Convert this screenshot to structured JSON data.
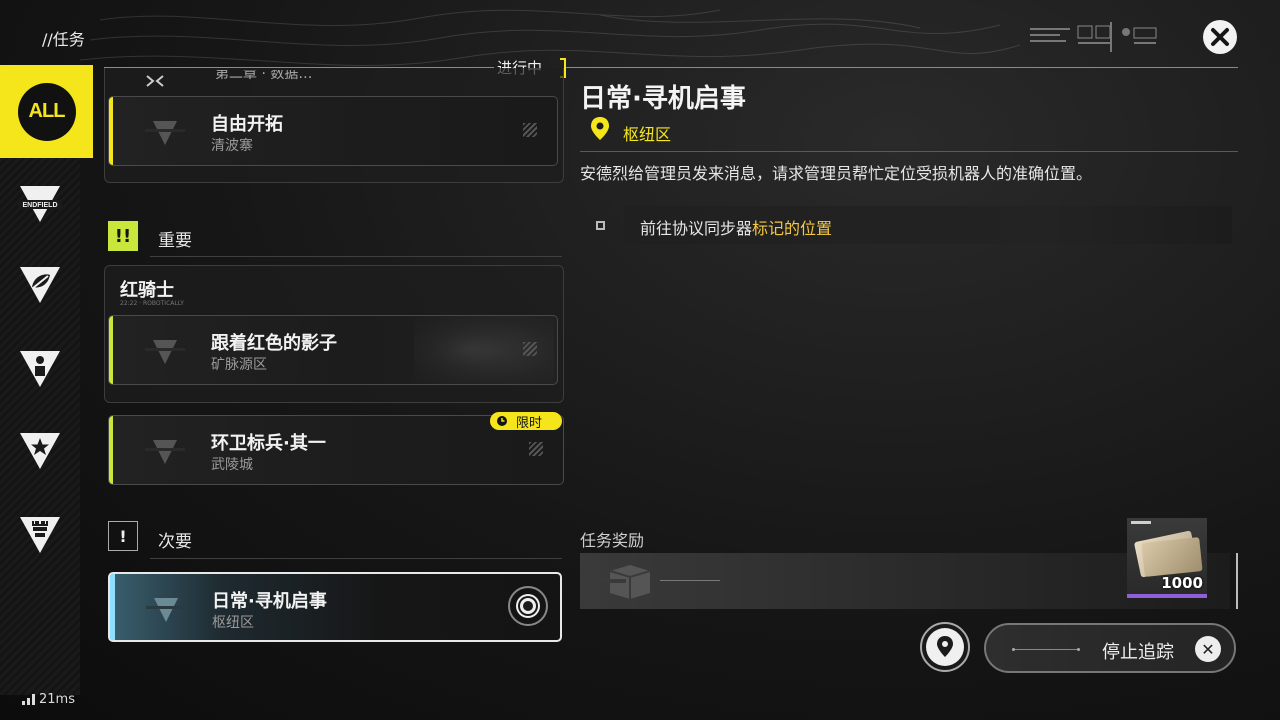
{
  "breadcrumb": "//任务",
  "ping": "21ms",
  "in_progress_label": "进行中",
  "sidebar": {
    "all_label": "ALL",
    "items": [
      {
        "icon": "endfield-icon",
        "label": "ENDFIELD"
      },
      {
        "icon": "leaf-icon"
      },
      {
        "icon": "person-icon"
      },
      {
        "icon": "star-icon"
      },
      {
        "icon": "tower-icon"
      }
    ]
  },
  "quests": {
    "top_partial": {
      "title_partial": "第二章 · 数据…",
      "name": "自由开拓",
      "location": "清波寨"
    },
    "important": {
      "heading": "重要",
      "badge": "!!",
      "group_title": "红骑士",
      "group_sub": "22:22 · ROBOTICALLY",
      "cards": [
        {
          "name": "跟着红色的影子",
          "location": "矿脉源区"
        },
        {
          "name": "环卫标兵·其一",
          "location": "武陵城",
          "tag": "限时"
        }
      ]
    },
    "minor": {
      "heading": "次要",
      "badge": "!",
      "cards": [
        {
          "name": "日常·寻机启事",
          "location": "枢纽区",
          "selected": true
        }
      ]
    }
  },
  "detail": {
    "title": "日常·寻机启事",
    "location": "枢纽区",
    "description": "安德烈给管理员发来消息，请求管理员帮忙定位受损机器人的准确位置。",
    "objective_prefix": "前往协议同步器",
    "objective_highlight": "标记的位置"
  },
  "rewards": {
    "title": "任务奖励",
    "item_qty": "1000"
  },
  "buttons": {
    "stop_tracking": "停止追踪"
  },
  "colors": {
    "accent_yellow": "#f5e61c",
    "accent_green": "#c8e63c",
    "highlight_orange": "#f5c841",
    "selected_blue": "#8fe0ff",
    "rarity_purple": "#8e5fd6"
  }
}
